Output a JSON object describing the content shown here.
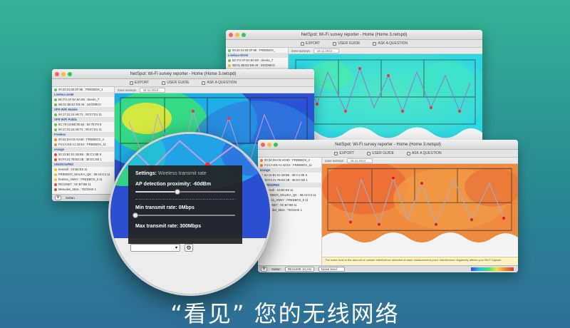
{
  "window_title": "NetSpot: Wi-Fi survey reporter - Home (Home 3.netspd)",
  "toolbar": {
    "export": "EXPORT",
    "user_guide": "USER GUIDE",
    "ask": "ASK A QUESTION"
  },
  "zone_tab": "Zone surveys",
  "date_tab": "18.11.2013 ...",
  "back_window_sidebar": [
    {
      "label": "00:24:01:60:3F:9E : FREEBOX_",
      "kind": "item",
      "dot": "g"
    },
    {
      "label": "Livebox-D0A9",
      "kind": "group"
    },
    {
      "label": "BC:F2:AF:6A:8A:69 : devolo_7",
      "kind": "item",
      "dot": "g"
    },
    {
      "label": "5B:01:3B:E2:D8:A9 : 24GDMC0",
      "kind": "item",
      "dot": "y"
    },
    {
      "label": "SFR WiFi Mobile",
      "kind": "group"
    }
  ],
  "front_left_sidebar": [
    {
      "label": "00:24:01:60:3F:9E : FREEBOX_1",
      "kind": "item",
      "dot": "g"
    },
    {
      "label": "Livebox-4A69",
      "kind": "group"
    },
    {
      "label": "BC:F2:AF:6A:8A:69 : devolo_7",
      "kind": "item",
      "dot": "g"
    },
    {
      "label": "5B:01:3B:E2:D8:A9 : 24GDMC0",
      "kind": "item",
      "dot": "g"
    },
    {
      "label": "SFR WiFi Mobile",
      "kind": "group"
    },
    {
      "label": "94:17:31:24:AB:71 : 00:27:D1 11",
      "kind": "item",
      "dot": "g"
    },
    {
      "label": "SFR WiFi Public",
      "kind": "group"
    },
    {
      "label": "6C:70:C8:BD:00:63 : 82:7E:F8 9",
      "kind": "item",
      "dot": "g"
    },
    {
      "label": "94:17:31:24:AB:71 : 00:27:D1 11",
      "kind": "item",
      "dot": "g"
    },
    {
      "label": "Freebox",
      "kind": "group"
    },
    {
      "label": "00:24:D4:C8:A0:60 : FREEBOX_4",
      "kind": "item",
      "dot": "o"
    },
    {
      "label": "F4:CA:E5:A1:42:E4 : FREEBOX_11",
      "kind": "item",
      "dot": "o"
    },
    {
      "label": "orange",
      "kind": "group"
    },
    {
      "label": "52:13:B1:01:1B:B5 : 3E:C1:8E 6",
      "kind": "item",
      "dot": "r"
    },
    {
      "label": "60:F4:21:7B:B2:2B : 3E:EC:6E 1",
      "kind": "item",
      "dot": "r"
    },
    {
      "label": "UNGROUPED",
      "kind": "group"
    },
    {
      "label": "tresSofi : 10:B4:E5 11",
      "kind": "item",
      "dot": "y"
    },
    {
      "label": "FREEBOX_MALIKA_QK : 68:A3:C4 11",
      "kind": "item",
      "dot": "y"
    },
    {
      "label": "freebox_ANNY : FREEBOX_6 11",
      "kind": "item",
      "dot": "y"
    },
    {
      "label": "RICONET : 0C:B7:8B 11",
      "kind": "item",
      "dot": "r"
    },
    {
      "label": "Menudes_552e : TEOSHK 1",
      "kind": "item",
      "dot": "r"
    }
  ],
  "front_right_sidebar": [
    {
      "label": "00:24:D4:C8:A0:60 : FREEBOX_4",
      "kind": "item",
      "dot": "o"
    },
    {
      "label": "F4:CA:E5:A1:42:E4 : FREEBOX_11",
      "kind": "item",
      "dot": "o"
    },
    {
      "label": "orange",
      "kind": "group"
    },
    {
      "label": "52:13:B1:01:1B:B5 : 3E:C1:8E 6",
      "kind": "item",
      "dot": "r"
    },
    {
      "label": "60:F4:21:7B:B2:2B : 3E:EC:6E 1",
      "kind": "item",
      "dot": "r"
    },
    {
      "label": "UNGROUPED",
      "kind": "group"
    },
    {
      "label": "tresSofi : 10:B4:E5 11",
      "kind": "item",
      "dot": "y"
    },
    {
      "label": "FREEBOX_MALIKA_QK : 68:A3:C4 11",
      "kind": "item",
      "dot": "y"
    },
    {
      "label": "freebox_ANNY : FREEBOX_6 11",
      "kind": "item",
      "dot": "y"
    },
    {
      "label": "RICONET : 0C:B7:8B 11",
      "kind": "item",
      "dot": "r"
    },
    {
      "label": "Menudes_552e : TEOSHK 1",
      "kind": "item",
      "dot": "r"
    }
  ],
  "status": {
    "scope": "Saltan",
    "resume": "RESUME SCAN",
    "select": "Noise level"
  },
  "note_text": "The noise level is the amount of outside interference detected at each measurement point. Interference negatively affects your Wi-Fi signals.",
  "settings_panel": {
    "title": "Settings:",
    "title_sub": "Wireless transmit rate",
    "ap_label": "AP detection proximity: -60dBm",
    "ap_level": 0.42,
    "min_label": "Min transmit rate: 0Mbps",
    "min_level": 0.0,
    "max_label": "Max transmit rate: 300Mbps",
    "max_level": 1.0
  },
  "behind_panel": {
    "rate": "... proximity: -60dBm",
    "min": "0Mbps",
    "max": "300Mbps",
    "title": "...wireless transmit rate"
  },
  "caption": "“看见” 您的无线网络",
  "colors": {
    "bg_top": "#34b395",
    "bg_bottom": "#2f6f97",
    "panel": "#222222"
  }
}
